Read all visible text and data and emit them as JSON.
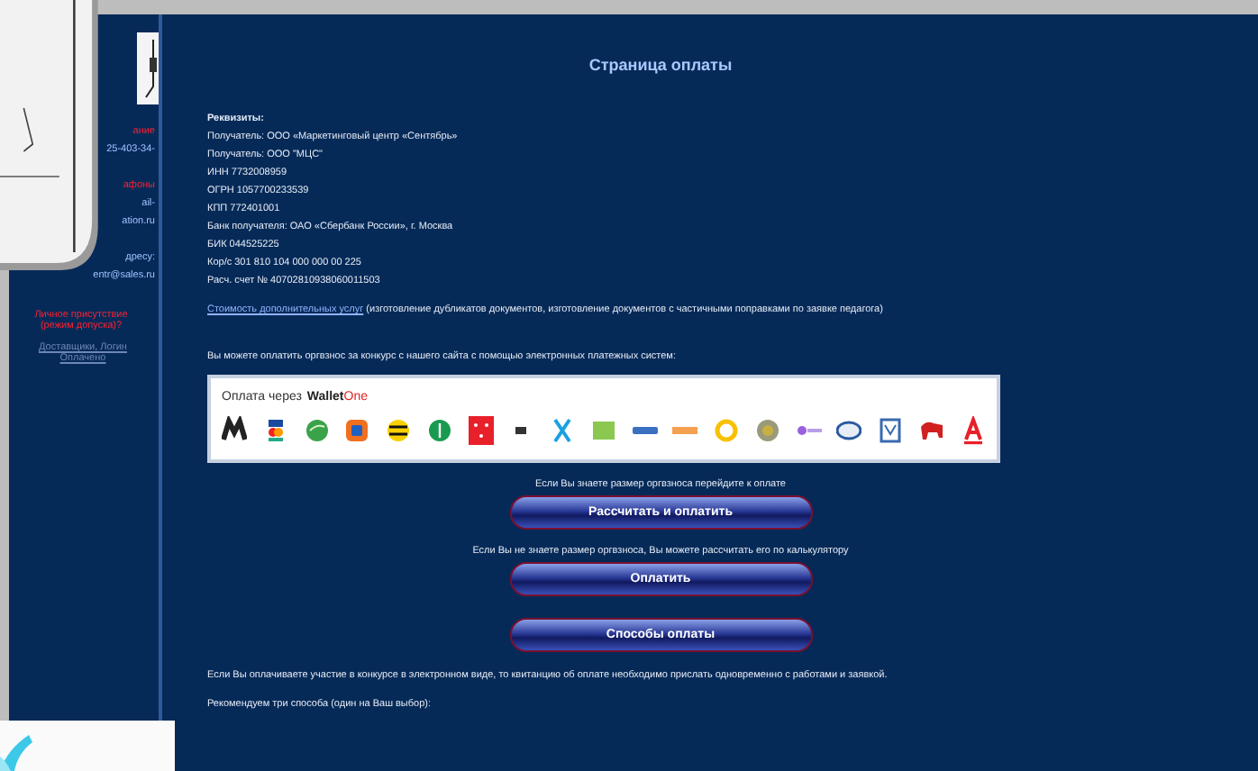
{
  "sidebar": {
    "items": [
      {
        "kind": "alert",
        "text": "ание"
      },
      {
        "kind": "contact",
        "text": "25-403-34-"
      },
      {
        "kind": "alert",
        "text": "афоны"
      },
      {
        "kind": "contact",
        "text": "ail-"
      },
      {
        "kind": "contact",
        "text": "ation.ru"
      },
      {
        "kind": "contact",
        "text": "дресу:"
      },
      {
        "kind": "contact",
        "text": "entr@sales.ru"
      },
      {
        "kind": "alert",
        "text": "Личное присутствие (режим допуска)?"
      },
      {
        "kind": "note",
        "text": "Доставщики, Логин Оплачено"
      }
    ]
  },
  "page": {
    "title": "Страница оплаты",
    "requisites": [
      "Реквизиты:",
      "Получатель: ООО «Маркетинговый центр «Сентябрь»",
      "Получатель: ООО \"МЦС\"",
      "ИНН 7732008959",
      "ОГРН 1057700233539",
      "КПП 772401001",
      "Банк получателя: ОАО «Сбербанк России», г. Москва",
      "БИК 044525225",
      "Кор/с 301 810 104 000 000 00 225",
      "Расч. счет № 40702810938060011503"
    ],
    "services": {
      "link": "Стоимость дополнительных услуг",
      "text": " (изготовление дубликатов документов, изготовление документов с частичными поправками по заявке педагога)"
    },
    "intro": "Вы можете оплатить оргвзнос за конкурс с нашего сайта с помощью электронных платежных систем:",
    "wallet": {
      "label": "Оплата через",
      "brand": "Wallet",
      "brand_accent": "One"
    },
    "actions": [
      {
        "prompt": "Если Вы знаете размер оргвзноса перейдите к оплате",
        "label": "Рассчитать и оплатить"
      },
      {
        "prompt": "Если Вы не знаете размер оргвзноса, Вы можете рассчитать его по калькулятору",
        "label": "Оплатить"
      },
      {
        "label": "Способы оплаты"
      }
    ],
    "notes": [
      "Если Вы оплачиваете участие в конкурсе в электронном виде, то квитанцию об оплате необходимо прислать одновременно с работами и заявкой.",
      "Рекомендуем три способа (один на Ваш выбор):"
    ]
  }
}
